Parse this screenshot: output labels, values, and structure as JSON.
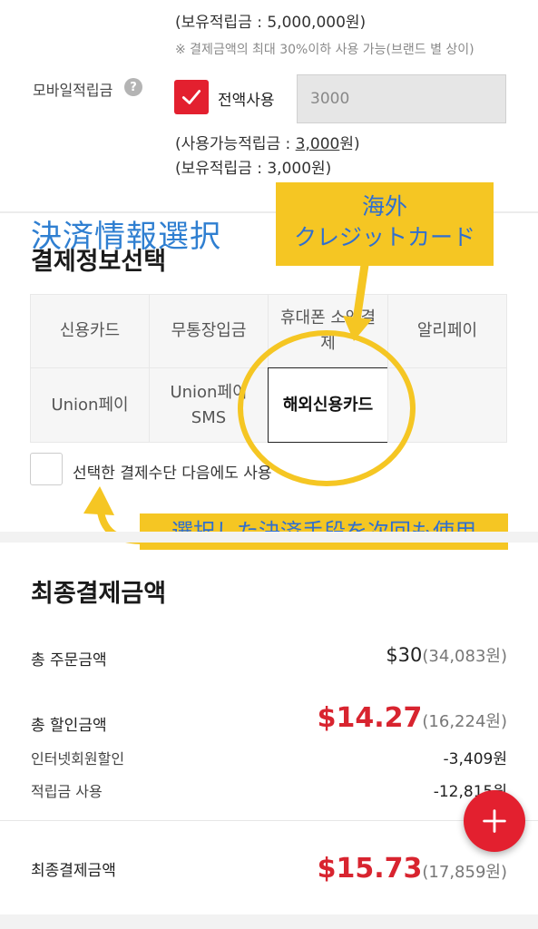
{
  "points": {
    "owned_points_top": "(보유적립금 : 5,000,000원)",
    "max_note": "※ 결제금액의 최대 30%이하 사용 가능(브랜드 별 상이)",
    "mobile_points_label": "모바일적립금",
    "help_icon": "?",
    "use_all_label": "전액사용",
    "input_value": "3000",
    "available_prefix": "(사용가능적립금 : ",
    "available_amount": "3,000",
    "available_suffix": "원)",
    "owned_points": "(보유적립금 : 3,000원)"
  },
  "annotations": {
    "payment_info_jp": "決済情報選択",
    "overseas_card_jp": "海外\nクレジットカード",
    "save_method_jp": "選択した決済手段を次回も使用"
  },
  "payment": {
    "title": "결제정보선택",
    "methods": [
      {
        "label": "신용카드"
      },
      {
        "label": "무통장입금"
      },
      {
        "label": "휴대폰 소액결제"
      },
      {
        "label": "알리페이"
      },
      {
        "label": "Union페이"
      },
      {
        "label": "Union페이 SMS"
      },
      {
        "label": "해외신용카드"
      }
    ],
    "selected_index": 6,
    "save_checkbox_label": "선택한 결제수단 다음에도 사용"
  },
  "final": {
    "title": "최종결제금액",
    "order_total_label": "총 주문금액",
    "order_total_usd": "$30",
    "order_total_krw": "(34,083원)",
    "discount_label": "총 할인금액",
    "discount_usd": "$14.27",
    "discount_krw": "(16,224원)",
    "member_discount_label": "인터넷회원할인",
    "member_discount_value": "-3,409원",
    "points_used_label": "적립금 사용",
    "points_used_value": "-12,815원",
    "final_label": "최종결제금액",
    "final_usd": "$15.73",
    "final_krw": "(17,859원)"
  },
  "colors": {
    "accent_red": "#e3202f",
    "price_red": "#d8242f",
    "annotation_yellow": "#f5c623",
    "annotation_blue": "#2f7fd1"
  }
}
